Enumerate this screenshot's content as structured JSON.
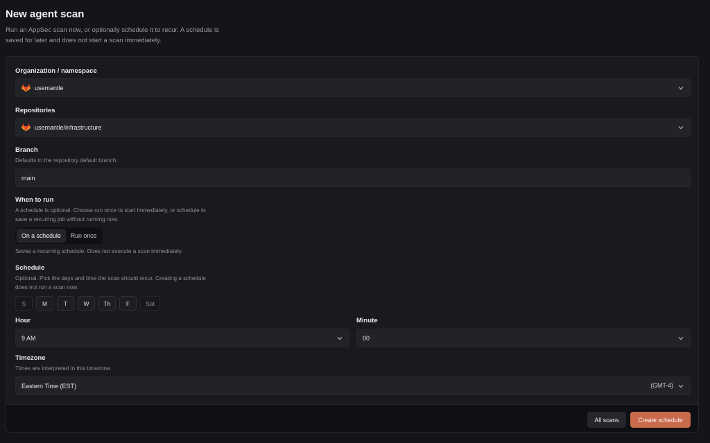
{
  "header": {
    "title": "New agent scan",
    "description": "Run an AppSec scan now, or optionally schedule it to recur. A schedule is saved for later and does not start a scan immediately."
  },
  "org": {
    "label": "Organization / namespace",
    "value": "usemantle",
    "icon": "gitlab-icon"
  },
  "repos": {
    "label": "Repositories",
    "value": "usemantle/infrastructure",
    "icon": "gitlab-icon"
  },
  "branch": {
    "label": "Branch",
    "help": "Defaults to the repository default branch.",
    "value": "main"
  },
  "when": {
    "label": "When to run",
    "help": "A schedule is optional. Choose run once to start immediately, or schedule to save a recurring job without running now.",
    "options": [
      "On a schedule",
      "Run once"
    ],
    "selected": "On a schedule",
    "note": "Saves a recurring schedule. Does not execute a scan immediately."
  },
  "schedule": {
    "label": "Schedule",
    "help": "Optional. Pick the days and time the scan should recur. Creating a schedule does not run a scan now.",
    "days": [
      {
        "label": "S",
        "selected": false
      },
      {
        "label": "M",
        "selected": true
      },
      {
        "label": "T",
        "selected": true
      },
      {
        "label": "W",
        "selected": true
      },
      {
        "label": "Th",
        "selected": true
      },
      {
        "label": "F",
        "selected": true
      },
      {
        "label": "Sat",
        "selected": false
      }
    ]
  },
  "hour": {
    "label": "Hour",
    "value": "9 AM"
  },
  "minute": {
    "label": "Minute",
    "value": "00"
  },
  "timezone": {
    "label": "Timezone",
    "help": "Times are interpreted in this timezone.",
    "value": "Eastern Time (EST)",
    "offset": "(GMT-4)"
  },
  "footer": {
    "all_scans": "All scans",
    "create": "Create schedule"
  },
  "colors": {
    "accent": "#c96a4d",
    "gitlab": "#e24329"
  }
}
